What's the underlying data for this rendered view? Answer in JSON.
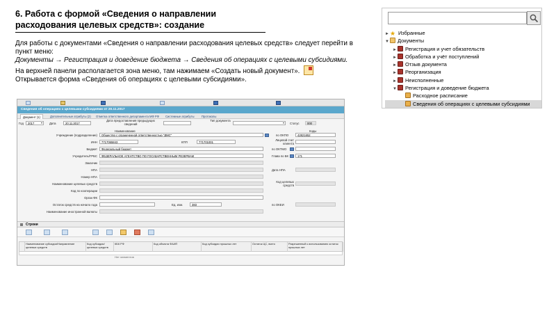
{
  "slide": {
    "title_line1": "6. Работа с формой «Сведения о направлении",
    "title_line2": "расходования целевых средств»: создание",
    "para1": "Для работы с документами «Сведения о направлении расходования целевых средств» следует перейти в пункт меню:",
    "para2": "Документы → Регистрация и доведение бюджета → Сведения об операциях с целевыми субсидиями.",
    "para3": "На верхней панели располагается зона меню, там нажимаем «Создать новый документ».",
    "para4": "Открывается форма «Сведения об операциях с целевыми субсидиями»."
  },
  "tree": {
    "items": [
      {
        "label": "Избранные",
        "icon": "star-icon",
        "indent": 0,
        "toggle": "►"
      },
      {
        "label": "Документы",
        "icon": "folder-icon",
        "indent": 0,
        "toggle": "▼"
      },
      {
        "label": "Регистрация и учет обязательств",
        "icon": "book-icon",
        "indent": 1,
        "toggle": "►"
      },
      {
        "label": "Обработка и учёт поступлений",
        "icon": "book-icon",
        "indent": 1,
        "toggle": "►"
      },
      {
        "label": "Отзыв документа",
        "icon": "book-icon",
        "indent": 1,
        "toggle": "►"
      },
      {
        "label": "Реорганизация",
        "icon": "book-icon",
        "indent": 1,
        "toggle": "►"
      },
      {
        "label": "Неисполненные",
        "icon": "book-icon",
        "indent": 1,
        "toggle": "►"
      },
      {
        "label": "Регистрация и доведение бюджета",
        "icon": "book-icon",
        "indent": 1,
        "toggle": "▼"
      },
      {
        "label": "Расходное расписание",
        "icon": "doc-icon",
        "indent": 2,
        "toggle": ""
      },
      {
        "label": "Сведения об операциях с целевыми субсидиями",
        "icon": "doc-icon",
        "indent": 2,
        "toggle": "",
        "selected": true
      }
    ]
  },
  "app": {
    "title": "Сведения об операциях с целевыми субсидиями от 20.11.2017",
    "tabs": [
      "Документ (1)",
      "Дополнительные атрибуты (2)",
      "Отметка ответственного департамента МФ РФ",
      "Системные атрибуты",
      "Протоколы"
    ],
    "form": {
      "god_label": "Год",
      "god_value": "2017",
      "date_label": "Дата",
      "date_value": "20.11.2017",
      "prev_date_label": "Дата предоставления предыдущих сведений",
      "tip_label": "Тип документа",
      "status_label": "Статус",
      "status_value": "000",
      "naim_header": "Наименование",
      "kody_header": "Коды",
      "uchr_label": "Учреждение (подразделение)",
      "uchr_value": "Общество с ограниченной ответственностью \"ДМС\"",
      "okpo_label": "по ОКПО",
      "okpo_value": "42821652",
      "inn_label": "ИНН",
      "inn_value": "7717065843",
      "kpp_label": "КПП",
      "kpp_value": "771701001",
      "lic_label": "Лицевой счет клиента",
      "budget_label": "Бюджет",
      "budget_value": "Федеральный бюджет",
      "oktmo_label": "по ОКТМО",
      "grbs_label": "Учредитель/ГРБС",
      "grbs_value": "ФЕДЕРАЛЬНОЕ АГЕНТСТВО ПО ГОСУДАРСТВЕННЫМ РЕЗЕРВАМ",
      "glava_label": "Глава по БК",
      "glava_value": "171",
      "zakaz_label": "Заказчик",
      "npa_label": "НПА",
      "date_npa_label": "Дата НПА",
      "nomer_npa_label": "Номер НПА",
      "naim_cel_label": "Наименование целевых средств",
      "kod_cel_label": "Код целевых средств",
      "kod_koop_label": "Код по кооперации",
      "organ_fk_label": "Орган ФК",
      "ostatok_label": "Остаток средств на начало года",
      "ed_izm_label": "Ед. изм.",
      "ed_izm_value": "383",
      "okei_label": "по ОКЕИ",
      "inval_label": "Наименование иностранной валюты",
      "ok_label": "ОК"
    },
    "rows": {
      "title": "Строки",
      "columns": [
        "Наименование субсидии/Направление целевых средств",
        "Код субсидии/целевых средств",
        "КБК РФ",
        "Код объекта ФАИП",
        "Код субсидии прошлых лет",
        "Остаток ЦС, всего",
        "Разрешенный к использованию остаток прошлых лет"
      ],
      "empty_text": "Нет элементов"
    }
  },
  "colors": {
    "titlebar": "#5aa7cc",
    "selected_row": "#d8d8d8",
    "go_button": "#5c88c4"
  }
}
